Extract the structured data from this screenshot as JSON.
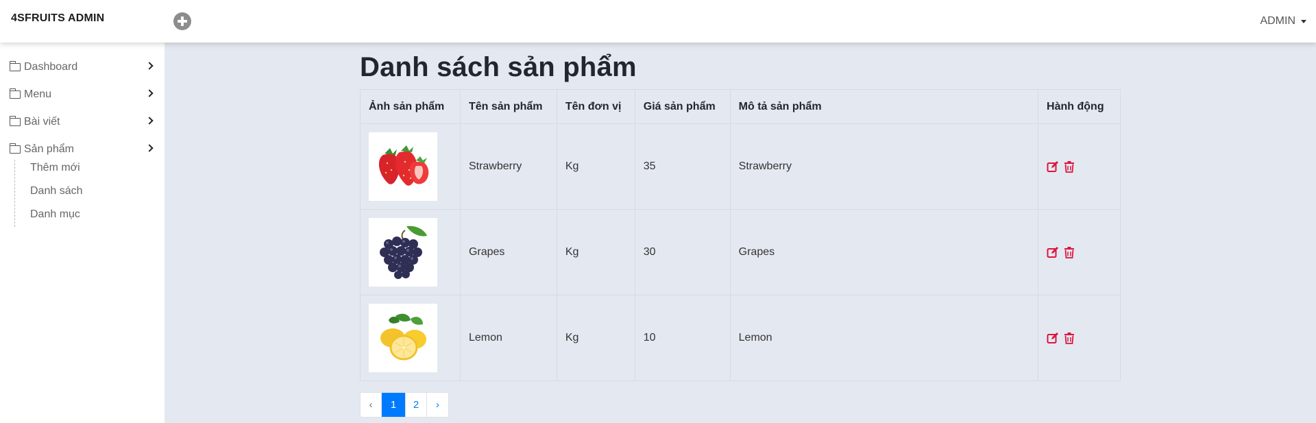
{
  "header": {
    "brand": "4SFRUITS ADMIN",
    "add_icon": "plus-circle-icon",
    "user_label": "ADMIN"
  },
  "sidebar": {
    "items": [
      {
        "label": "Dashboard",
        "icon": "folder-icon"
      },
      {
        "label": "Menu",
        "icon": "folder-icon"
      },
      {
        "label": "Bài viết",
        "icon": "folder-icon"
      },
      {
        "label": "Sản phẩm",
        "icon": "folder-icon",
        "expanded": true
      }
    ],
    "submenu": [
      {
        "label": "Thêm mới"
      },
      {
        "label": "Danh sách"
      },
      {
        "label": "Danh mục"
      }
    ]
  },
  "main": {
    "title": "Danh sách sản phẩm",
    "columns": [
      "Ảnh sản phẩm",
      "Tên sản phẩm",
      "Tên đơn vị",
      "Giá sản phẩm",
      "Mô tả sản phẩm",
      "Hành động"
    ],
    "rows": [
      {
        "image": "strawberry-image",
        "name": "Strawberry",
        "unit": "Kg",
        "price": "35",
        "description": "Strawberry"
      },
      {
        "image": "grapes-image",
        "name": "Grapes",
        "unit": "Kg",
        "price": "30",
        "description": "Grapes"
      },
      {
        "image": "lemon-image",
        "name": "Lemon",
        "unit": "Kg",
        "price": "10",
        "description": "Lemon"
      }
    ],
    "action_icons": [
      "edit-icon",
      "trash-icon"
    ],
    "action_color": "#dc143c"
  },
  "pagination": {
    "prev": "‹",
    "pages": [
      "1",
      "2"
    ],
    "active_page": "1",
    "next": "›"
  },
  "colors": {
    "background": "#e4e8f0",
    "accent": "#007bff"
  }
}
